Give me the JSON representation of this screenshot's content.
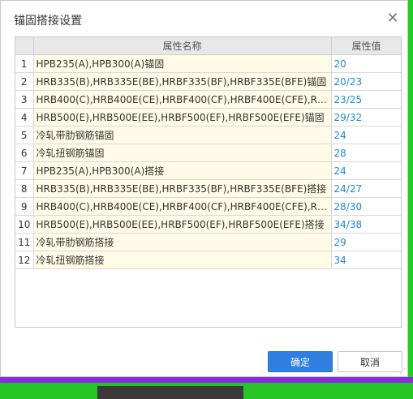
{
  "dialog": {
    "title": "锚固搭接设置",
    "close_icon": "close-icon"
  },
  "table": {
    "headers": [
      "",
      "属性名称",
      "属性值"
    ],
    "rows": [
      {
        "no": "1",
        "name": "HPB235(A),HPB300(A)锚固",
        "value": "20"
      },
      {
        "no": "2",
        "name": "HRB335(B),HRB335E(BE),HRBF335(BF),HRBF335E(BFE)锚固",
        "value": "20/23"
      },
      {
        "no": "3",
        "name": "HRB400(C),HRB400E(CE),HRBF400(CF),HRBF400E(CFE),RRB40...",
        "value": "23/25"
      },
      {
        "no": "4",
        "name": "HRB500(E),HRB500E(EE),HRBF500(EF),HRBF500E(EFE)锚固",
        "value": "29/32"
      },
      {
        "no": "5",
        "name": "冷轧带肋钢筋锚固",
        "value": "24"
      },
      {
        "no": "6",
        "name": "冷轧扭钢筋锚固",
        "value": "28"
      },
      {
        "no": "7",
        "name": "HPB235(A),HPB300(A)搭接",
        "value": "24"
      },
      {
        "no": "8",
        "name": "HRB335(B),HRB335E(BE),HRBF335(BF),HRBF335E(BFE)搭接",
        "value": "24/27"
      },
      {
        "no": "9",
        "name": "HRB400(C),HRB400E(CE),HRBF400(CF),HRBF400E(CFE),RRB40...",
        "value": "28/30"
      },
      {
        "no": "10",
        "name": "HRB500(E),HRB500E(EE),HRBF500(EF),HRBF500E(EFE)搭接",
        "value": "34/38"
      },
      {
        "no": "11",
        "name": "冷轧带肋钢筋搭接",
        "value": "29"
      },
      {
        "no": "12",
        "name": "冷轧扭钢筋搭接",
        "value": "34"
      }
    ]
  },
  "buttons": {
    "ok": "确定",
    "cancel": "取消"
  },
  "colors": {
    "accent": "#2f7fe0",
    "value_text": "#1e88d8",
    "name_cell_bg": "#fffbe6",
    "background_green": "#22cc22",
    "background_purple": "#8a2be2"
  }
}
